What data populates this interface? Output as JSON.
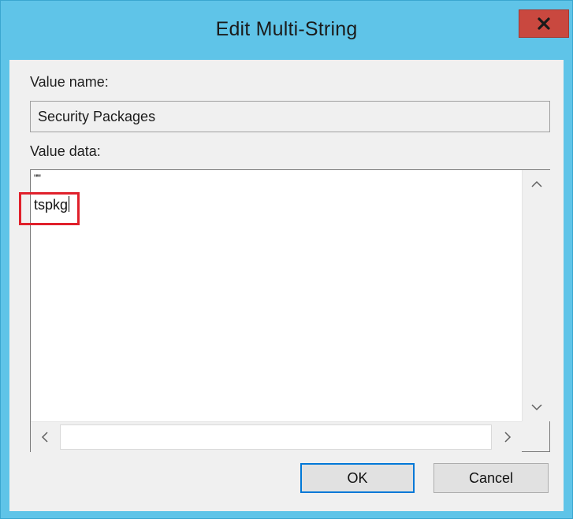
{
  "window": {
    "title": "Edit Multi-String",
    "close_glyph": "x"
  },
  "value_name": {
    "label": "Value name:",
    "value": "Security Packages"
  },
  "value_data": {
    "label": "Value data:",
    "lines": [
      "\"\"",
      "tspkg"
    ]
  },
  "buttons": {
    "ok": "OK",
    "cancel": "Cancel"
  },
  "colors": {
    "titlebar": "#5fc4e8",
    "close_button": "#c9483f",
    "highlight_box": "#e0202b",
    "default_button_border": "#0078d7"
  },
  "icons": {
    "close": "close-icon",
    "scroll_up": "chevron-up-icon",
    "scroll_down": "chevron-down-icon",
    "scroll_left": "chevron-left-icon",
    "scroll_right": "chevron-right-icon"
  }
}
